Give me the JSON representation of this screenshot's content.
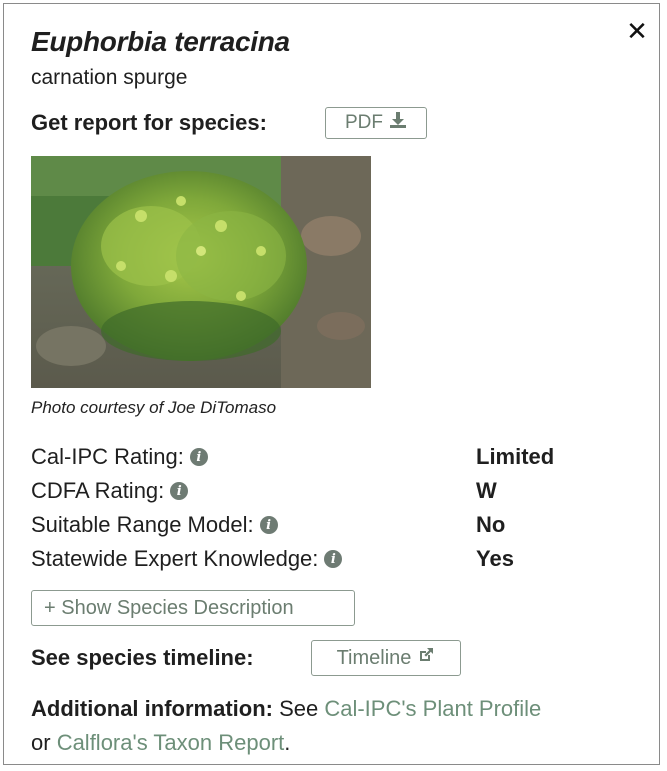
{
  "species": {
    "scientific_name": "Euphorbia terracina",
    "common_name": "carnation spurge"
  },
  "report": {
    "label": "Get report for species:",
    "pdf_button": "PDF",
    "pdf_icon": "download-icon"
  },
  "photo": {
    "caption": "Photo courtesy of Joe DiTomaso"
  },
  "ratings": [
    {
      "label": "Cal-IPC Rating:",
      "value": "Limited"
    },
    {
      "label": "CDFA Rating:",
      "value": "W"
    },
    {
      "label": "Suitable Range Model:",
      "value": "No"
    },
    {
      "label": "Statewide Expert Knowledge:",
      "value": "Yes"
    }
  ],
  "description_button": "+ Show Species Description",
  "timeline": {
    "label": "See species timeline:",
    "button": "Timeline",
    "icon": "external-link-icon"
  },
  "additional": {
    "label": "Additional information:",
    "text_see": " See ",
    "link1": "Cal-IPC's Plant Profile",
    "text_or": "or ",
    "link2": "Calflora's Taxon Report",
    "text_end": "."
  },
  "close_symbol": "✕",
  "colors": {
    "accent_text": "#6d8f79",
    "button_border": "#8c9a90",
    "info_icon": "#6e7b73"
  }
}
